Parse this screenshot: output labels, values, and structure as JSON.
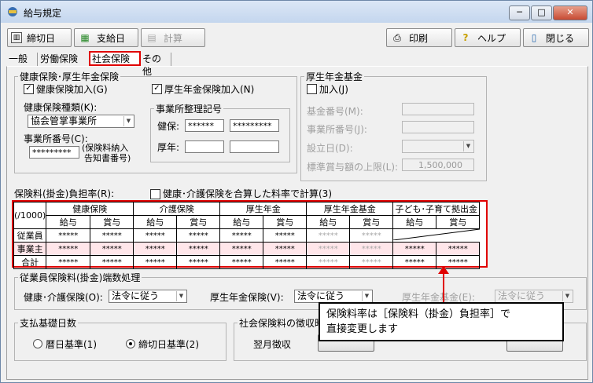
{
  "window": {
    "title": "給与規定",
    "controls": {
      "minimize": "─",
      "maximize": "□",
      "close": "✕"
    }
  },
  "toolbar": {
    "closing_day": "締切日",
    "payment_day": "支給日",
    "calculate": "計算",
    "print": "印刷",
    "help": "ヘルプ",
    "close": "閉じる"
  },
  "tabs": [
    "一般",
    "労働保険",
    "社会保険",
    "その他"
  ],
  "health_pension": {
    "legend": "健康保険･厚生年金保険",
    "health_join": "健康保険加入(G)",
    "pension_join": "厚生年金保険加入(N)",
    "health_type_label": "健康保険種類(K):",
    "health_type_value": "協会管掌事業所",
    "office_number_label": "事業所番号(C):",
    "office_number_value": "*********",
    "office_number_note_1": "(保険料納入",
    "office_number_note_2": "告知書番号)",
    "registration": {
      "legend": "事業所整理記号",
      "health_label": "健保:",
      "health_value_1": "******",
      "health_value_2": "*********",
      "pension_label": "厚年:",
      "pension_value_1": "",
      "pension_value_2": ""
    }
  },
  "pension_fund": {
    "legend": "厚生年金基金",
    "join": "加入(J)",
    "fund_number_label": "基金番号(M):",
    "office_number_label": "事業所番号(J):",
    "established_label": "設立日(D):",
    "ceiling_label": "標準賞与額の上限(L):",
    "ceiling_value": "1,500,000"
  },
  "rates": {
    "label": "保険料(掛金)負担率(R):",
    "combined_check": "健康･介護保険を合算した料率で計算(3)",
    "unit": "(/1000)",
    "groups": [
      "健康保険",
      "介護保険",
      "厚生年金",
      "厚生年金基金",
      "子ども･子育て拠出金"
    ],
    "sub_headers": [
      "給与",
      "賞与",
      "給与",
      "賞与",
      "給与",
      "賞与",
      "給与",
      "賞与",
      "給与",
      "賞与"
    ],
    "rows": [
      {
        "label": "従業員",
        "values": [
          "*****",
          "*****",
          "*****",
          "*****",
          "*****",
          "*****",
          "*****",
          "*****",
          "",
          ""
        ]
      },
      {
        "label": "事業主",
        "values": [
          "*****",
          "*****",
          "*****",
          "*****",
          "*****",
          "*****",
          "*****",
          "*****",
          "*****",
          "*****"
        ]
      },
      {
        "label": "合計",
        "values": [
          "*****",
          "*****",
          "*****",
          "*****",
          "*****",
          "*****",
          "*****",
          "*****",
          "*****",
          "*****"
        ]
      }
    ]
  },
  "rounding": {
    "legend": "従業員保険料(掛金)端数処理",
    "health_label": "健康･介護保険(O):",
    "health_value": "法令に従う",
    "pension_label": "厚生年金保険(V):",
    "pension_value": "法令に従う",
    "fund_label": "厚生年金基金(E):",
    "fund_value": "法令に従う"
  },
  "basis": {
    "legend": "支払基礎日数",
    "calendar": "暦日基準(1)",
    "closing": "締切日基準(2)"
  },
  "collection": {
    "legend": "社会保険料の徴収時期",
    "value": "翌月徴収"
  },
  "callout": {
    "line1": "保険料率は［保険料（掛金）負担率］で",
    "line2": "直接変更します"
  }
}
